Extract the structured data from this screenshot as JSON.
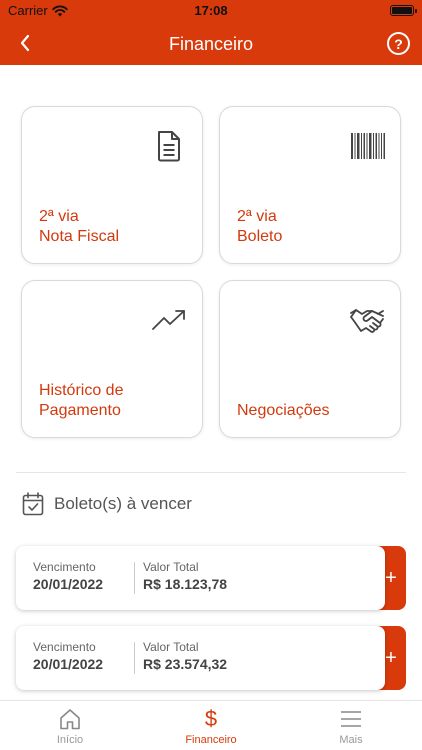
{
  "status_bar": {
    "carrier": "Carrier",
    "time": "17:08"
  },
  "header": {
    "title": "Financeiro",
    "back_icon": "chevron-left-icon",
    "help_icon": "help-circle-icon",
    "help_glyph": "?"
  },
  "cards": [
    {
      "line1": "2ª via",
      "line2": "Nota Fiscal",
      "icon": "document-icon"
    },
    {
      "line1": "2ª via",
      "line2": "Boleto",
      "icon": "barcode-icon"
    },
    {
      "line1": "Histórico de",
      "line2": "Pagamento",
      "icon": "trending-up-icon"
    },
    {
      "line1": "",
      "line2": "Negociações",
      "icon": "handshake-icon"
    }
  ],
  "section": {
    "title": "Boleto(s) à vencer",
    "icon": "calendar-check-icon"
  },
  "boletos": [
    {
      "vencimento_label": "Vencimento",
      "vencimento": "20/01/2022",
      "valor_label": "Valor Total",
      "valor": "R$ 18.123,78",
      "add": "+"
    },
    {
      "vencimento_label": "Vencimento",
      "vencimento": "20/01/2022",
      "valor_label": "Valor Total",
      "valor": "R$ 23.574,32",
      "add": "+"
    }
  ],
  "tabs": [
    {
      "label": "Início",
      "icon": "home-icon"
    },
    {
      "label": "Financeiro",
      "icon": "dollar-icon",
      "glyph": "$"
    },
    {
      "label": "Mais",
      "icon": "menu-icon"
    }
  ],
  "colors": {
    "brand": "#d83a0c",
    "accent_text": "#d23a0e"
  }
}
